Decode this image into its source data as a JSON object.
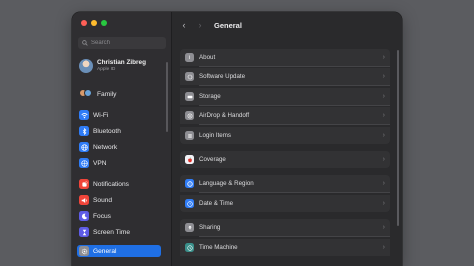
{
  "sidebar": {
    "search_placeholder": "Search",
    "profile": {
      "name": "Christian Zibreg",
      "subtitle": "Apple ID"
    },
    "family_label": "Family",
    "items": [
      {
        "label": "Wi-Fi",
        "icon": "wifi-icon",
        "color": "#2f7cf6"
      },
      {
        "label": "Bluetooth",
        "icon": "bluetooth-icon",
        "color": "#2f7cf6"
      },
      {
        "label": "Network",
        "icon": "globe-icon",
        "color": "#2f7cf6"
      },
      {
        "label": "VPN",
        "icon": "vpn-icon",
        "color": "#2f7cf6"
      },
      {
        "label": "Notifications",
        "icon": "bell-icon",
        "color": "#f0453a"
      },
      {
        "label": "Sound",
        "icon": "speaker-icon",
        "color": "#f0453a"
      },
      {
        "label": "Focus",
        "icon": "moon-icon",
        "color": "#5e5ce6"
      },
      {
        "label": "Screen Time",
        "icon": "hourglass-icon",
        "color": "#5e5ce6"
      },
      {
        "label": "General",
        "icon": "gear-icon",
        "color": "#8e8e93",
        "active": true
      }
    ]
  },
  "header": {
    "back": "‹",
    "forward": "›",
    "title": "General"
  },
  "rows": [
    {
      "label": "About",
      "icon": "info-icon",
      "color": "#8e8e93"
    },
    {
      "label": "Software Update",
      "icon": "gear-badge-icon",
      "color": "#8e8e93"
    },
    {
      "label": "Storage",
      "icon": "drive-icon",
      "color": "#8e8e93"
    },
    {
      "label": "AirDrop & Handoff",
      "icon": "airdrop-icon",
      "color": "#8e8e93"
    },
    {
      "label": "Login Items",
      "icon": "list-icon",
      "color": "#8e8e93"
    },
    {
      "label": "Coverage",
      "icon": "apple-icon",
      "color": "#f2f2f7"
    },
    {
      "label": "Language & Region",
      "icon": "globe-icon",
      "color": "#2f7cf6"
    },
    {
      "label": "Date & Time",
      "icon": "clock-icon",
      "color": "#2f7cf6"
    },
    {
      "label": "Sharing",
      "icon": "sharing-icon",
      "color": "#8e8e93"
    },
    {
      "label": "Time Machine",
      "icon": "time-machine-icon",
      "color": "#3a8f8a"
    }
  ],
  "chevron": "›"
}
